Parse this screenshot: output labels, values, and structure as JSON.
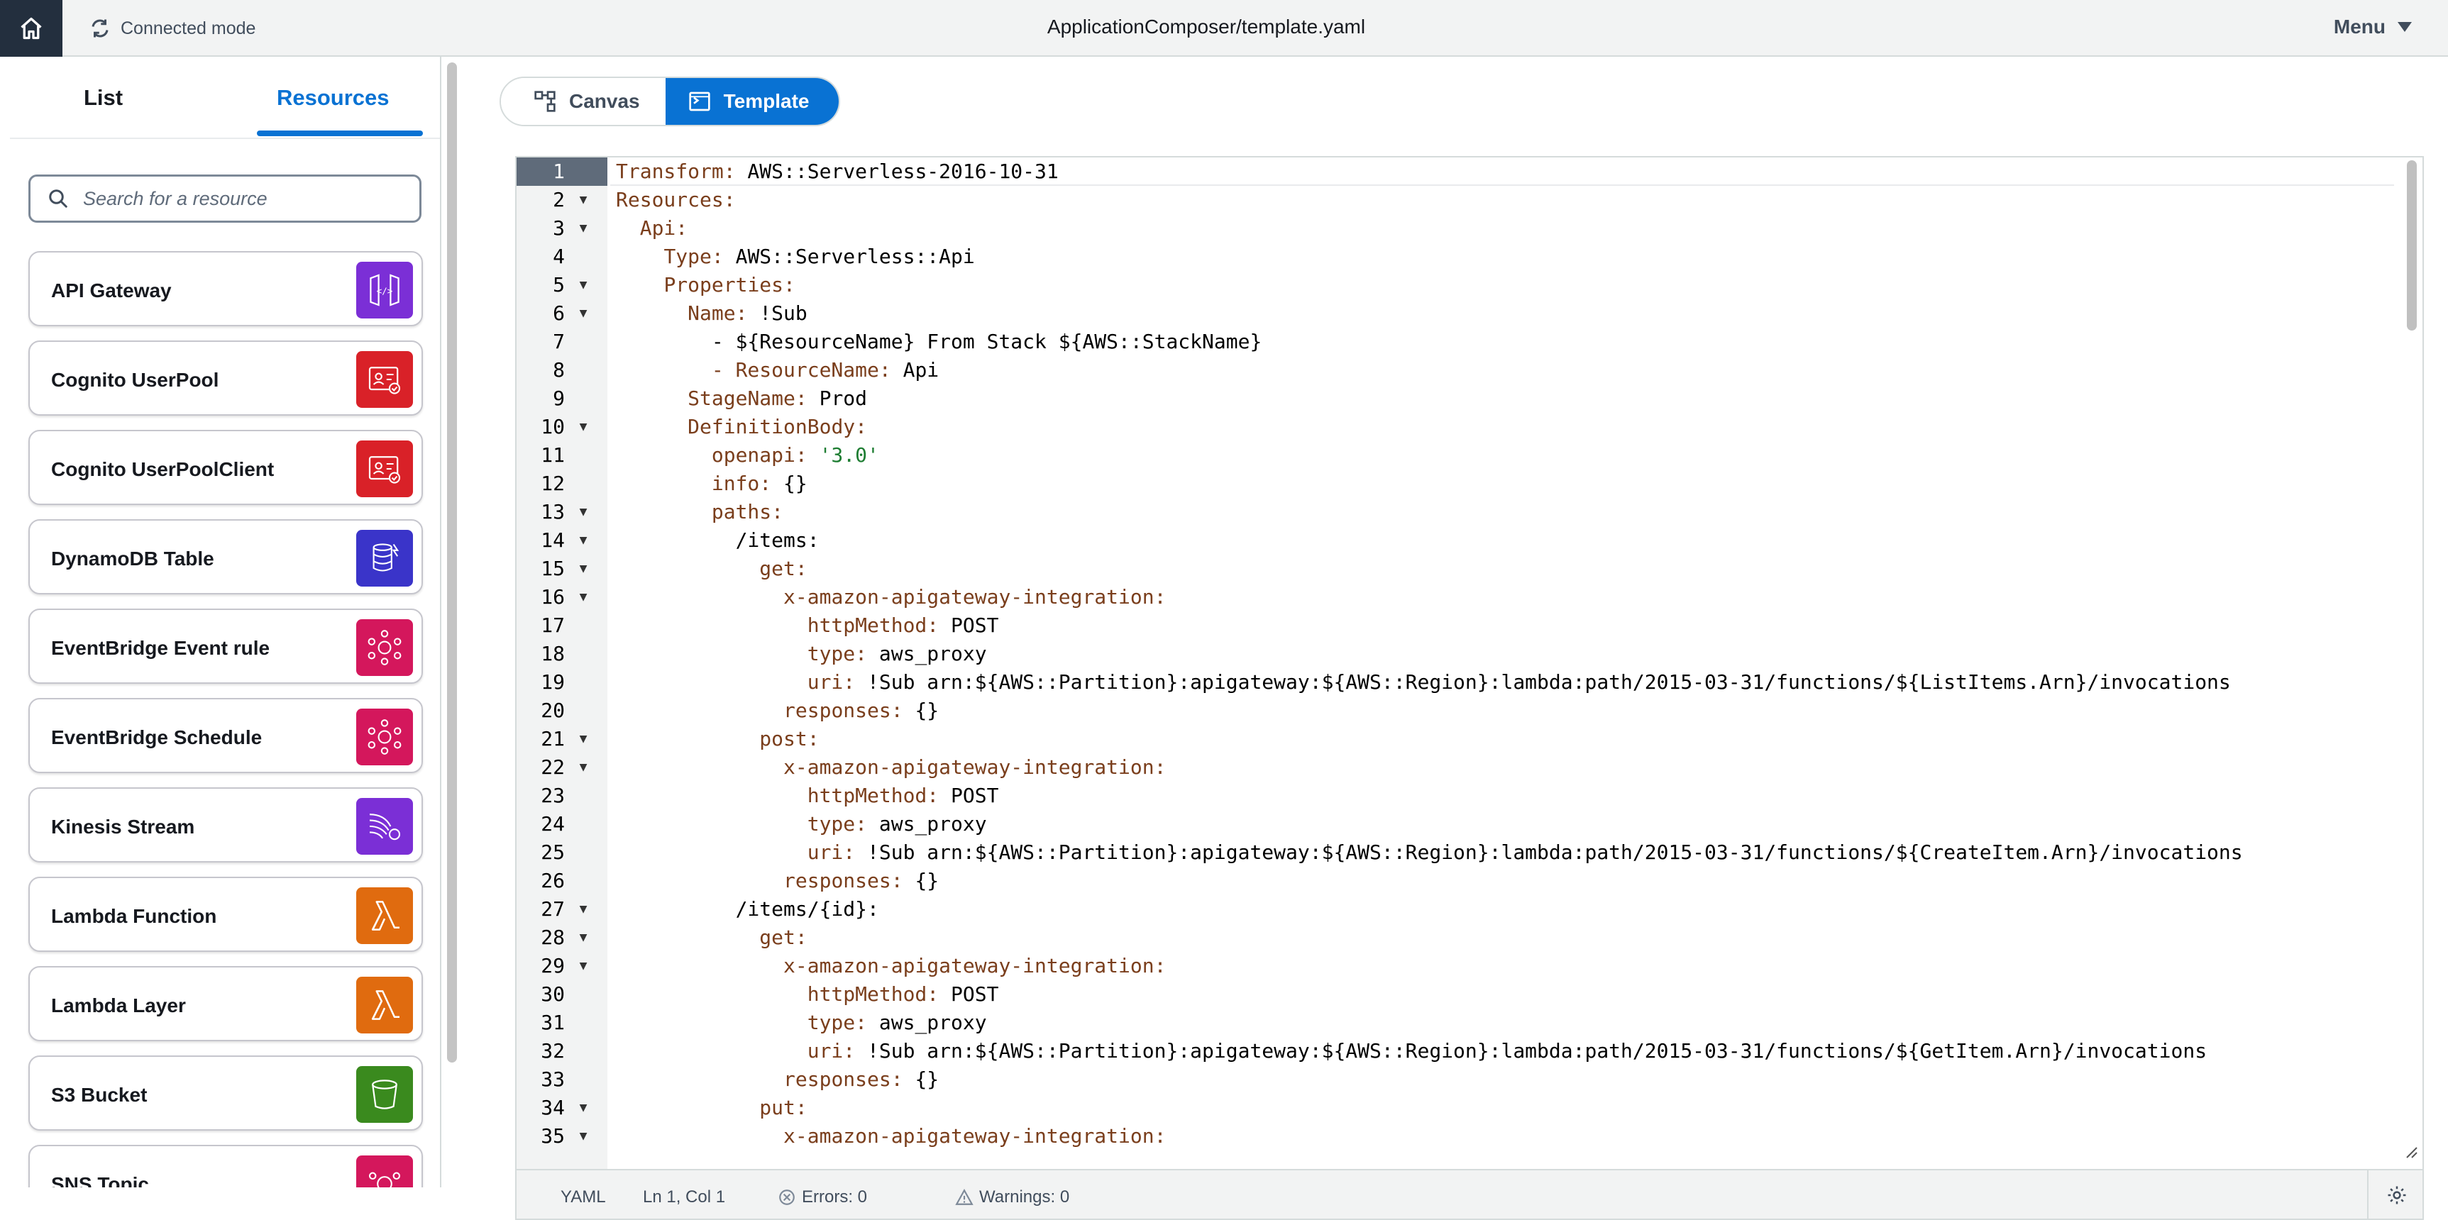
{
  "topbar": {
    "home_icon": "home-icon",
    "mode_label": "Connected mode",
    "title": "ApplicationComposer/template.yaml",
    "menu_label": "Menu"
  },
  "left_panel": {
    "tabs": [
      "List",
      "Resources"
    ],
    "active_tab": "Resources",
    "search_placeholder": "Search for a resource",
    "resources": [
      {
        "label": "API Gateway",
        "icon": "api-gateway-icon",
        "color": "#7b2fd6"
      },
      {
        "label": "Cognito UserPool",
        "icon": "cognito-userpool-icon",
        "color": "#d92128"
      },
      {
        "label": "Cognito UserPoolClient",
        "icon": "cognito-userpoolclient-icon",
        "color": "#d92128"
      },
      {
        "label": "DynamoDB Table",
        "icon": "dynamodb-table-icon",
        "color": "#3a34c9"
      },
      {
        "label": "EventBridge Event rule",
        "icon": "eventbridge-rule-icon",
        "color": "#d4175c"
      },
      {
        "label": "EventBridge Schedule",
        "icon": "eventbridge-schedule-icon",
        "color": "#d4175c"
      },
      {
        "label": "Kinesis Stream",
        "icon": "kinesis-stream-icon",
        "color": "#7b2fd6"
      },
      {
        "label": "Lambda Function",
        "icon": "lambda-function-icon",
        "color": "#e06b0f"
      },
      {
        "label": "Lambda Layer",
        "icon": "lambda-layer-icon",
        "color": "#e06b0f"
      },
      {
        "label": "S3 Bucket",
        "icon": "s3-bucket-icon",
        "color": "#3a8a1e"
      },
      {
        "label": "SNS Topic",
        "icon": "sns-topic-icon",
        "color": "#d4175c"
      }
    ]
  },
  "view_toggle": {
    "canvas_label": "Canvas",
    "template_label": "Template",
    "active": "Template"
  },
  "editor": {
    "active_line": 1,
    "lines": [
      {
        "n": "1",
        "fold": false,
        "key": "Transform:",
        "val": " AWS::Serverless-2016-10-31",
        "indent": 0
      },
      {
        "n": "2",
        "fold": true,
        "key": "Resources:",
        "val": "",
        "indent": 0
      },
      {
        "n": "3",
        "fold": true,
        "key": "Api:",
        "val": "",
        "indent": 2
      },
      {
        "n": "4",
        "fold": false,
        "key": "Type:",
        "val": " AWS::Serverless::Api",
        "indent": 4
      },
      {
        "n": "5",
        "fold": true,
        "key": "Properties:",
        "val": "",
        "indent": 4
      },
      {
        "n": "6",
        "fold": true,
        "key": "Name:",
        "val": " !Sub",
        "indent": 6
      },
      {
        "n": "7",
        "fold": false,
        "key": "",
        "val": "- ${ResourceName} From Stack ${AWS::StackName}",
        "indent": 8
      },
      {
        "n": "8",
        "fold": false,
        "key": "- ResourceName:",
        "val": " Api",
        "indent": 8
      },
      {
        "n": "9",
        "fold": false,
        "key": "StageName:",
        "val": " Prod",
        "indent": 6
      },
      {
        "n": "10",
        "fold": true,
        "key": "DefinitionBody:",
        "val": "",
        "indent": 6
      },
      {
        "n": "11",
        "fold": false,
        "key": "openapi:",
        "val": " '3.0'",
        "indent": 8,
        "val_string": true
      },
      {
        "n": "12",
        "fold": false,
        "key": "info:",
        "val": " {}",
        "indent": 8
      },
      {
        "n": "13",
        "fold": true,
        "key": "paths:",
        "val": "",
        "indent": 8
      },
      {
        "n": "14",
        "fold": true,
        "key": "",
        "val": "/items:",
        "indent": 10
      },
      {
        "n": "15",
        "fold": true,
        "key": "get:",
        "val": "",
        "indent": 12
      },
      {
        "n": "16",
        "fold": true,
        "key": "x-amazon-apigateway-integration:",
        "val": "",
        "indent": 14
      },
      {
        "n": "17",
        "fold": false,
        "key": "httpMethod:",
        "val": " POST",
        "indent": 16
      },
      {
        "n": "18",
        "fold": false,
        "key": "type:",
        "val": " aws_proxy",
        "indent": 16
      },
      {
        "n": "19",
        "fold": false,
        "key": "uri:",
        "val": " !Sub arn:${AWS::Partition}:apigateway:${AWS::Region}:lambda:path/2015-03-31/functions/${ListItems.Arn}/invocations",
        "indent": 16
      },
      {
        "n": "20",
        "fold": false,
        "key": "responses:",
        "val": " {}",
        "indent": 14
      },
      {
        "n": "21",
        "fold": true,
        "key": "post:",
        "val": "",
        "indent": 12
      },
      {
        "n": "22",
        "fold": true,
        "key": "x-amazon-apigateway-integration:",
        "val": "",
        "indent": 14
      },
      {
        "n": "23",
        "fold": false,
        "key": "httpMethod:",
        "val": " POST",
        "indent": 16
      },
      {
        "n": "24",
        "fold": false,
        "key": "type:",
        "val": " aws_proxy",
        "indent": 16
      },
      {
        "n": "25",
        "fold": false,
        "key": "uri:",
        "val": " !Sub arn:${AWS::Partition}:apigateway:${AWS::Region}:lambda:path/2015-03-31/functions/${CreateItem.Arn}/invocations",
        "indent": 16
      },
      {
        "n": "26",
        "fold": false,
        "key": "responses:",
        "val": " {}",
        "indent": 14
      },
      {
        "n": "27",
        "fold": true,
        "key": "",
        "val": "/items/{id}:",
        "indent": 10
      },
      {
        "n": "28",
        "fold": true,
        "key": "get:",
        "val": "",
        "indent": 12
      },
      {
        "n": "29",
        "fold": true,
        "key": "x-amazon-apigateway-integration:",
        "val": "",
        "indent": 14
      },
      {
        "n": "30",
        "fold": false,
        "key": "httpMethod:",
        "val": " POST",
        "indent": 16
      },
      {
        "n": "31",
        "fold": false,
        "key": "type:",
        "val": " aws_proxy",
        "indent": 16
      },
      {
        "n": "32",
        "fold": false,
        "key": "uri:",
        "val": " !Sub arn:${AWS::Partition}:apigateway:${AWS::Region}:lambda:path/2015-03-31/functions/${GetItem.Arn}/invocations",
        "indent": 16
      },
      {
        "n": "33",
        "fold": false,
        "key": "responses:",
        "val": " {}",
        "indent": 14
      },
      {
        "n": "34",
        "fold": true,
        "key": "put:",
        "val": "",
        "indent": 12
      },
      {
        "n": "35",
        "fold": true,
        "key": "x-amazon-apigateway-integration:",
        "val": "",
        "indent": 14
      }
    ]
  },
  "statusbar": {
    "language": "YAML",
    "position": "Ln 1, Col 1",
    "errors": "Errors: 0",
    "warnings": "Warnings: 0",
    "settings_icon": "gear-icon"
  }
}
